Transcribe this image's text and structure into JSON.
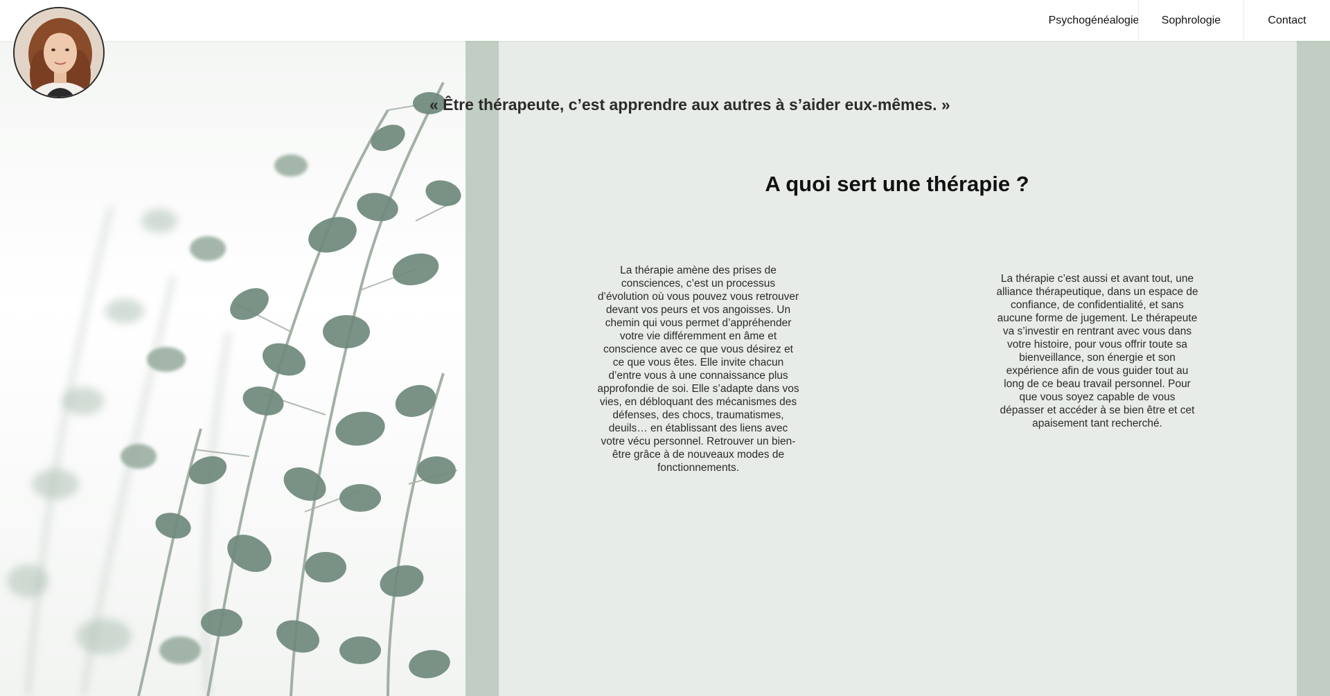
{
  "nav": {
    "items": [
      "Psychogénéalogie",
      "Sophrologie",
      "Contact"
    ]
  },
  "main": {
    "quote": "« Être thérapeute, c’est apprendre aux autres à s’aider eux-mêmes. »",
    "heading": "A quoi sert une thérapie ?",
    "paragraph_left": "La thérapie amène des prises de consciences, c’est un processus d’évolution où vous pouvez vous retrouver devant vos peurs et vos angoisses. Un chemin qui vous permet d’appréhender votre vie différemment en âme et conscience avec ce que vous désirez et ce que vous êtes. Elle invite chacun d’entre vous à une connaissance plus approfondie de soi. Elle s’adapte dans vos vies, en débloquant des mécanismes des défenses, des chocs, traumatismes, deuils… en établissant des liens avec votre vécu personnel. Retrouver un bien-être grâce à de nouveaux modes de fonctionnements.",
    "paragraph_right": "La thérapie c’est aussi et avant tout, une alliance thérapeutique, dans un espace de confiance, de confidentialité, et sans aucune forme de jugement. Le thérapeute va s’investir en rentrant avec vous dans votre histoire, pour vous offrir toute sa bienveillance, son énergie et son expérience afin de vous guider tout au long de ce beau travail personnel. Pour que vous soyez capable de vous dépasser et accéder à se bien être et cet apaisement tant recherché."
  },
  "colors": {
    "panel_bg": "#e8ece8",
    "accent_green": "#c2cec3",
    "leaf": "#6f8a7c"
  }
}
